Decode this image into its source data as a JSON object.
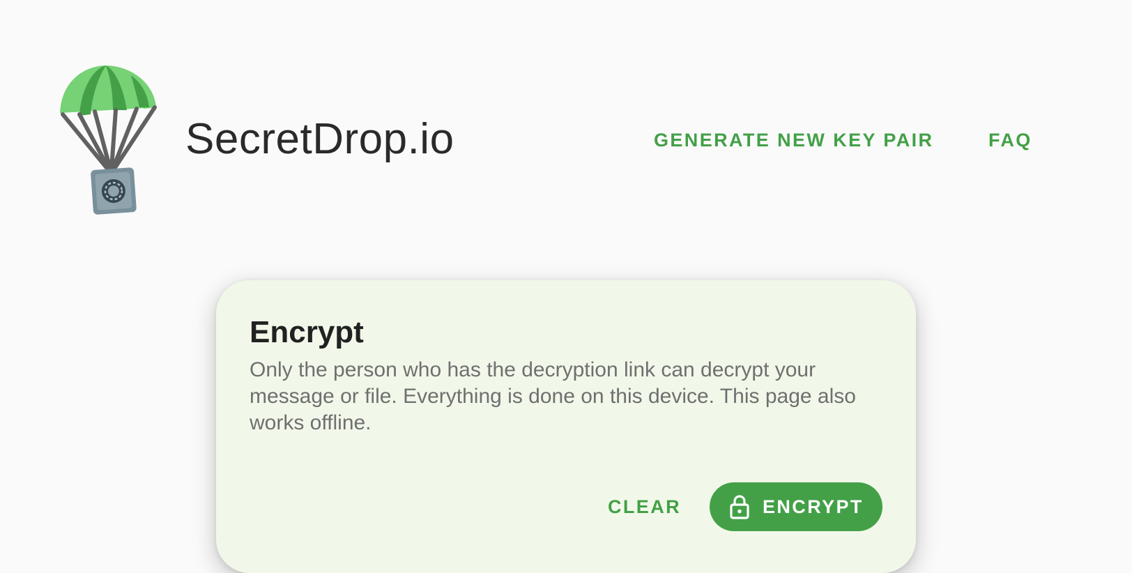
{
  "header": {
    "brand": "SecretDrop.io",
    "nav": {
      "generate_key_pair": "GENERATE NEW KEY PAIR",
      "faq": "FAQ"
    }
  },
  "card": {
    "title": "Encrypt",
    "description": "Only the person who has the decryption link can decrypt your message or file. Everything is done on this device. This page also works offline.",
    "clear_label": "CLEAR",
    "encrypt_label": "ENCRYPT"
  },
  "icons": {
    "logo": "parachute-safe-icon",
    "encrypt_button": "lock-icon"
  },
  "colors": {
    "accent": "#43a047",
    "card_background": "#f1f8e9",
    "page_background": "#fafafa"
  }
}
